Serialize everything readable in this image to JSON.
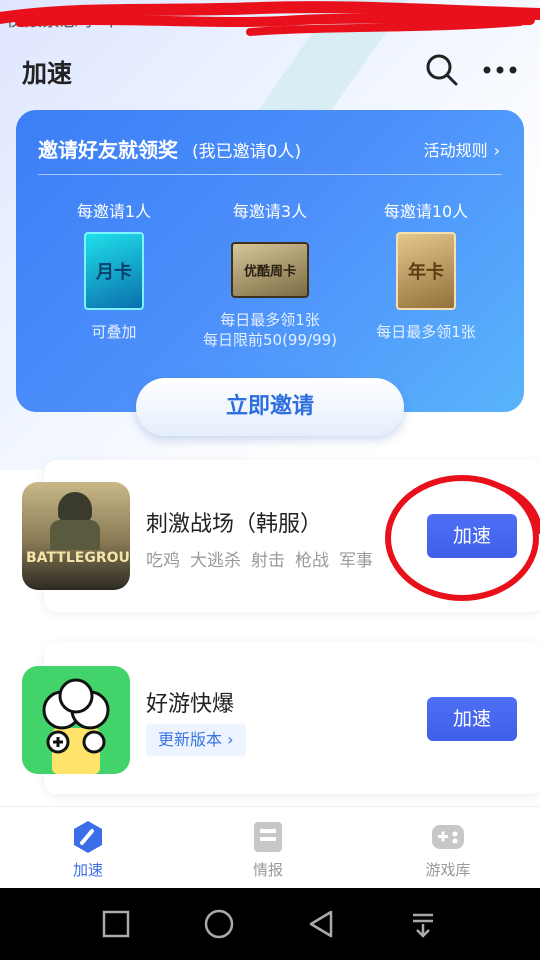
{
  "status_bar": {
    "left_text": "仅限紧急呼叫",
    "right_text": ""
  },
  "header": {
    "title": "加速"
  },
  "invite": {
    "title": "邀请好友就领奖",
    "subtitle": "(我已邀请0人)",
    "rules": "活动规则",
    "rewards": [
      {
        "label": "每邀请1人",
        "card_text": "月卡",
        "note_1": "可叠加",
        "note_2": ""
      },
      {
        "label": "每邀请3人",
        "card_text": "优酷周卡",
        "note_1": "每日最多领1张",
        "note_2": "每日限前50(99/99)"
      },
      {
        "label": "每邀请10人",
        "card_text": "年卡",
        "note_1": "每日最多领1张",
        "note_2": ""
      }
    ],
    "button": "立即邀请"
  },
  "games": [
    {
      "title": "刺激战场（韩服）",
      "tags": [
        "吃鸡",
        "大逃杀",
        "射击",
        "枪战",
        "军事"
      ],
      "button": "加速",
      "icon_text": "BATTLEGROUNDS"
    },
    {
      "title": "好游快爆",
      "badge": "更新版本",
      "button": "加速"
    }
  ],
  "tabs": [
    {
      "label": "加速",
      "active": true
    },
    {
      "label": "情报",
      "active": false
    },
    {
      "label": "游戏库",
      "active": false
    }
  ],
  "colors": {
    "accent": "#3b6fe8",
    "card_blue": "#4d90fb",
    "annotation_red": "#e8101a"
  }
}
